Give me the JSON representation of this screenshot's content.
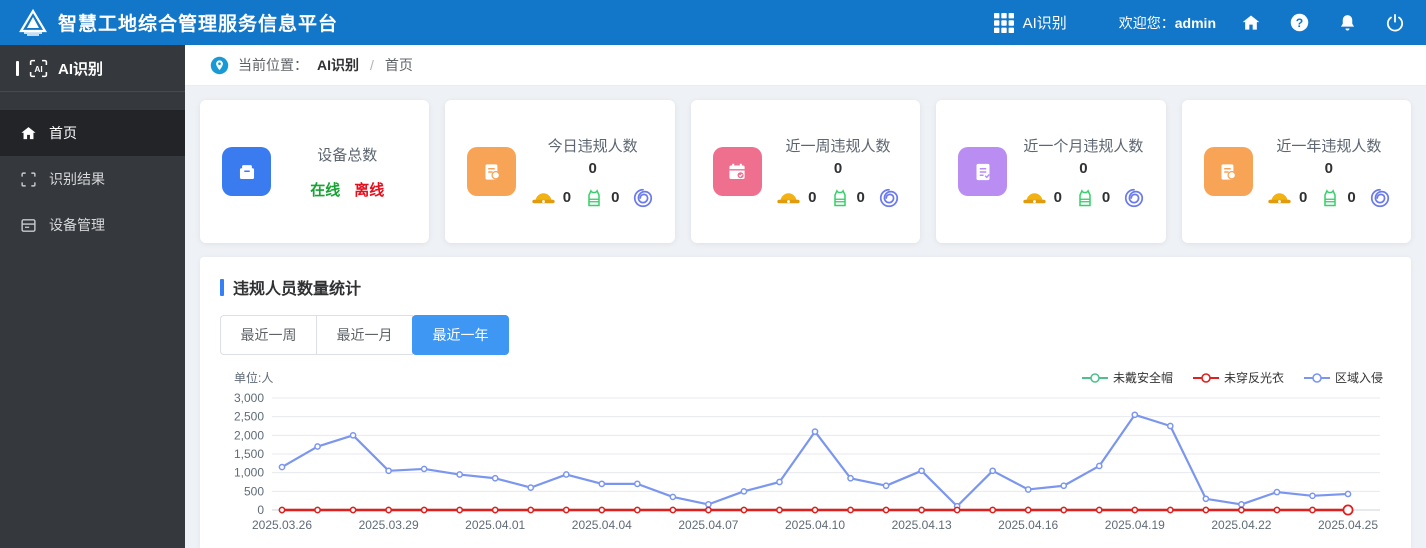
{
  "header": {
    "brand": "智慧工地综合管理服务信息平台",
    "app_switcher_label": "AI识别",
    "welcome_label": "欢迎您：",
    "username": "admin",
    "bar_color": "#1277c8"
  },
  "sidebar": {
    "title": "AI识别",
    "items": [
      {
        "label": "首页",
        "icon": "home-icon",
        "active": true
      },
      {
        "label": "识别结果",
        "icon": "scan-icon",
        "active": false
      },
      {
        "label": "设备管理",
        "icon": "device-icon",
        "active": false
      }
    ]
  },
  "breadcrumb": {
    "label": "当前位置：",
    "root": "AI识别",
    "sep": "/",
    "current": "首页"
  },
  "cards": [
    {
      "title": "设备总数",
      "online_label": "在线",
      "offline_label": "离线",
      "icon_color": "#3a7bf0"
    },
    {
      "title": "今日违规人数",
      "value": "0",
      "hat_count": "0",
      "vest_count": "0",
      "icon_color": "#f7a456"
    },
    {
      "title": "近一周违规人数",
      "value": "0",
      "hat_count": "0",
      "vest_count": "0",
      "icon_color": "#ef6f8e"
    },
    {
      "title": "近一个月违规人数",
      "value": "0",
      "hat_count": "0",
      "vest_count": "0",
      "icon_color": "#b98df2"
    },
    {
      "title": "近一年违规人数",
      "value": "0",
      "hat_count": "0",
      "vest_count": "0",
      "icon_color": "#f7a456"
    }
  ],
  "stats_panel": {
    "title": "违规人员数量统计",
    "tabs": [
      {
        "label": "最近一周",
        "active": false
      },
      {
        "label": "最近一月",
        "active": false
      },
      {
        "label": "最近一年",
        "active": true
      }
    ],
    "unit_label": "单位:人"
  },
  "chart_data": {
    "type": "line",
    "title": "违规人员数量统计",
    "ylabel": "单位:人",
    "ylim": [
      0,
      3000
    ],
    "y_ticks": [
      0,
      500,
      1000,
      1500,
      2000,
      2500,
      3000
    ],
    "grid": true,
    "legend_position": "top-right",
    "x": [
      "2025.03.26",
      "2025.03.27",
      "2025.03.28",
      "2025.03.29",
      "2025.03.30",
      "2025.03.31",
      "2025.04.01",
      "2025.04.02",
      "2025.04.03",
      "2025.04.04",
      "2025.04.05",
      "2025.04.06",
      "2025.04.07",
      "2025.04.08",
      "2025.04.09",
      "2025.04.10",
      "2025.04.11",
      "2025.04.12",
      "2025.04.13",
      "2025.04.14",
      "2025.04.15",
      "2025.04.16",
      "2025.04.17",
      "2025.04.18",
      "2025.04.19",
      "2025.04.20",
      "2025.04.21",
      "2025.04.22",
      "2025.04.23",
      "2025.04.24",
      "2025.04.25"
    ],
    "x_tick_labels": [
      "2025.03.26",
      "2025.03.29",
      "2025.04.01",
      "2025.04.04",
      "2025.04.07",
      "2025.04.10",
      "2025.04.13",
      "2025.04.16",
      "2025.04.19",
      "2025.04.22",
      "2025.04.25"
    ],
    "series": [
      {
        "name": "未戴安全帽",
        "color": "#4fc08d",
        "values": [
          0,
          0,
          0,
          0,
          0,
          0,
          0,
          0,
          0,
          0,
          0,
          0,
          0,
          0,
          0,
          0,
          0,
          0,
          0,
          0,
          0,
          0,
          0,
          0,
          0,
          0,
          0,
          0,
          0,
          0,
          0
        ]
      },
      {
        "name": "未穿反光衣",
        "color": "#e01f1f",
        "values": [
          0,
          0,
          0,
          0,
          0,
          0,
          0,
          0,
          0,
          0,
          0,
          0,
          0,
          0,
          0,
          0,
          0,
          0,
          0,
          0,
          0,
          0,
          0,
          0,
          0,
          0,
          0,
          0,
          0,
          0,
          0
        ]
      },
      {
        "name": "区域入侵",
        "color": "#7b96ee",
        "values": [
          1150,
          1700,
          2000,
          1050,
          1100,
          950,
          850,
          600,
          950,
          700,
          700,
          350,
          150,
          500,
          750,
          2100,
          850,
          650,
          1050,
          100,
          1050,
          550,
          650,
          1180,
          2550,
          2250,
          300,
          150,
          480,
          380,
          430
        ]
      }
    ]
  }
}
